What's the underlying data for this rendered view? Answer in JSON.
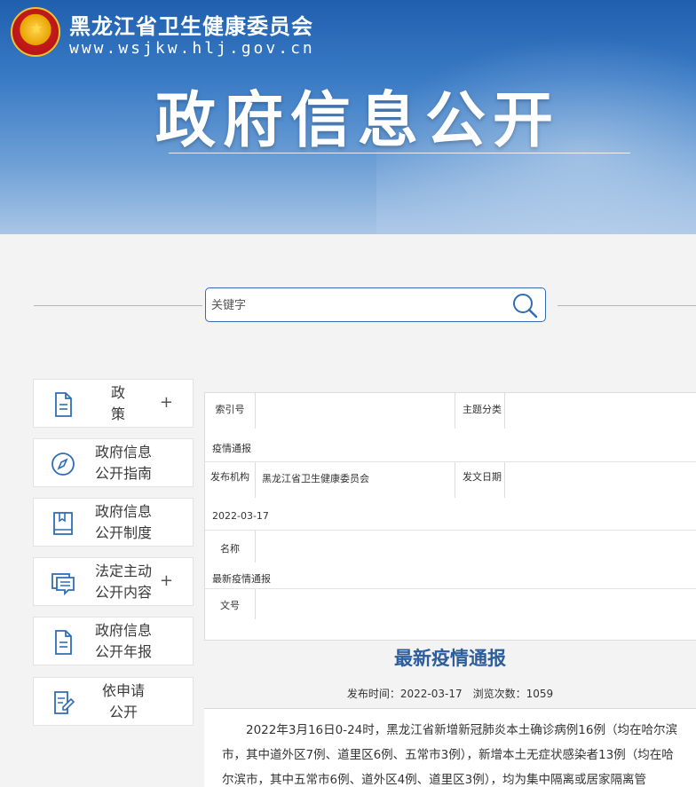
{
  "header": {
    "org_name": "黑龙江省卫生健康委员会",
    "url": "www.wsjkw.hlj.gov.cn",
    "title": "政府信息公开"
  },
  "search": {
    "placeholder": "关键字"
  },
  "sidebar": {
    "items": [
      {
        "label_lines": [
          "政　策"
        ],
        "has_plus": true,
        "icon": "document-icon"
      },
      {
        "label_lines": [
          "政府信息",
          "公开指南"
        ],
        "has_plus": false,
        "icon": "compass-icon"
      },
      {
        "label_lines": [
          "政府信息",
          "公开制度"
        ],
        "has_plus": false,
        "icon": "book-icon"
      },
      {
        "label_lines": [
          "法定主动",
          "公开内容"
        ],
        "has_plus": true,
        "icon": "chat-list-icon"
      },
      {
        "label_lines": [
          "政府信息",
          "公开年报"
        ],
        "has_plus": false,
        "icon": "document-icon"
      },
      {
        "label_lines": [
          "依申请",
          "公开"
        ],
        "has_plus": false,
        "icon": "edit-document-icon"
      }
    ],
    "plus_symbol": "+"
  },
  "info": {
    "index_label": "索引号",
    "index_value": "",
    "topic_label": "主题分类",
    "topic_value": "疫情通报",
    "publisher_label": "发布机构",
    "publisher_value": "黑龙江省卫生健康委员会",
    "date_label": "发文日期",
    "date_value": "2022-03-17",
    "name_label": "名称",
    "name_value": "最新疫情通报",
    "docno_label": "文号",
    "docno_value": ""
  },
  "article": {
    "title": "最新疫情通报",
    "meta": "发布时间：2022-03-17　浏览次数：1059",
    "body": "2022年3月16日0-24时，黑龙江省新增新冠肺炎本土确诊病例16例（均在哈尔滨市，其中道外区7例、道里区6例、五常市3例），新增本土无症状感染者13例（均在哈尔滨市，其中五常市6例、道外区4例、道里区3例），均为集中隔离或居家隔离管"
  },
  "colors": {
    "accent": "#2f6db5",
    "title_blue": "#2c5d9c",
    "banner": "#1f5fae"
  }
}
